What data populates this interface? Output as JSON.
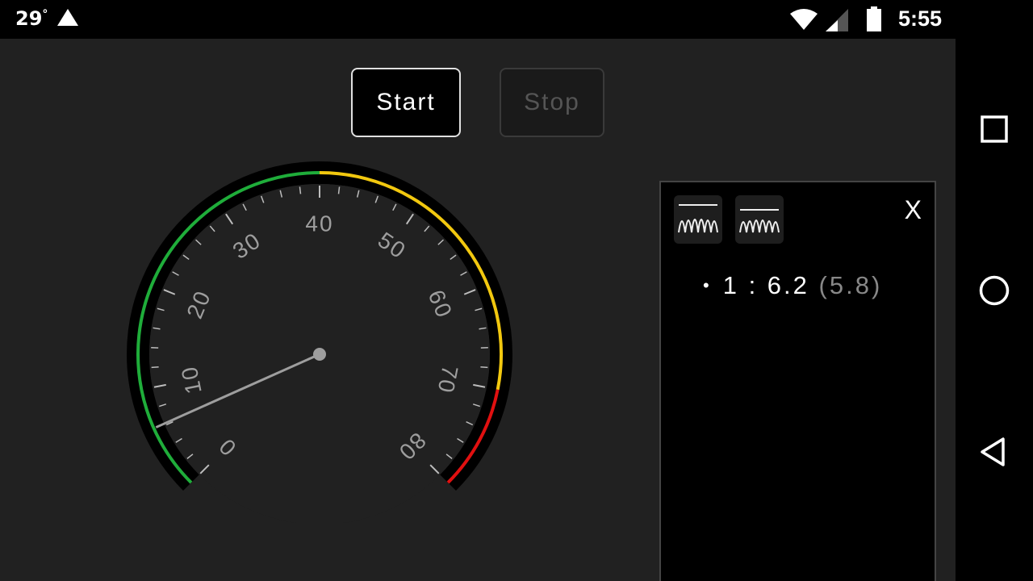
{
  "status": {
    "temperature": "29",
    "degree": "°",
    "time": "5:55",
    "icons": [
      "alert-triangle-icon",
      "wifi-icon",
      "signal-icon",
      "battery-icon"
    ]
  },
  "controls": {
    "start_label": "Start",
    "stop_label": "Stop"
  },
  "gauge": {
    "min": 0,
    "max": 80,
    "value": 6.2,
    "tick_labels": [
      "0",
      "10",
      "20",
      "30",
      "40",
      "50",
      "60",
      "70",
      "80"
    ],
    "zones": [
      {
        "from": 0,
        "to": 40,
        "color": "#1fad3a"
      },
      {
        "from": 40,
        "to": 70,
        "color": "#f2c80f"
      },
      {
        "from": 70,
        "to": 80,
        "color": "#e01010"
      }
    ]
  },
  "panel": {
    "icons": [
      "spectrum-icon",
      "spectrum-alt-icon"
    ],
    "close_label": "X",
    "reading": {
      "bullet": "•",
      "index": "1",
      "separator": " : ",
      "value": "6.2",
      "secondary": "(5.8)"
    }
  },
  "nav": {
    "icons": [
      "recents-square-icon",
      "home-circle-icon",
      "back-triangle-icon"
    ]
  },
  "colors": {
    "background": "#212121",
    "panel": "#000000",
    "needle": "#9e9e9e",
    "tick_label": "#9e9e9e"
  }
}
